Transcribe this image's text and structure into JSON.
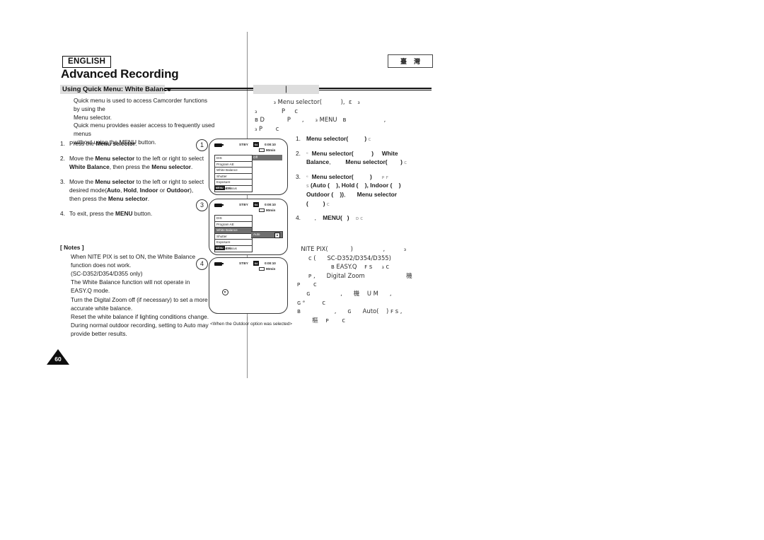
{
  "header": {
    "language_badge": "ENGLISH",
    "locale_badge_chars": [
      "臺",
      "灣"
    ],
    "chapter_title": "Advanced Recording"
  },
  "section": {
    "left_title": "Using Quick Menu: White Balance",
    "right_title": "|"
  },
  "intro": {
    "lines": [
      "Quick menu is used to access Camcorder functions by using the",
      "Menu selector.",
      "Quick menu provides easier access to frequently used menus",
      "without using the MENU button."
    ]
  },
  "steps": [
    {
      "num": "1.",
      "html": "Press the <b>Menu selector</b>."
    },
    {
      "num": "2.",
      "html": "Move the <b>Menu selector</b> to the left or right to select<br><b>White Balance</b>, then press the <b>Menu selector</b>."
    },
    {
      "num": "3.",
      "html": "Move the <b>Menu selector</b> to the left or right to select<br>desired mode(<b>Auto</b>, <b>Hold</b>, <b>Indoor</b> or <b>Outdoor</b>),<br>then press the <b>Menu selector</b>."
    },
    {
      "num": "4.",
      "html": "To exit, press the <b>MENU</b> button."
    }
  ],
  "notes": {
    "title": "[ Notes ]",
    "lines": [
      "When NITE PIX is set to ON, the White Balance",
      "function does not work.",
      "(SC-D352/D354/D355 only)",
      "The White Balance function will not operate in",
      "EASY.Q mode.",
      "Turn the Digital Zoom off (if necessary) to set a more",
      "accurate white balance.",
      "Reset the white balance if lighting conditions change.",
      "During normal outdoor recording, setting to Auto may",
      "provide better results."
    ]
  },
  "screens": {
    "markers": [
      "1",
      "3",
      "4"
    ],
    "status": {
      "stby": "STBY",
      "mode_badge": "64",
      "timecode": "0:00:10",
      "tape_remaining": "90min"
    },
    "menu_items": [
      "DIS",
      "Program AE",
      "White Balance",
      "Shutter",
      "Exposure",
      "Manual Focus"
    ],
    "screen1": {
      "highlight_label": "DIS",
      "highlight_value": "Off"
    },
    "screen3": {
      "highlight_label": "White Balance",
      "highlight_value": "Auto",
      "value_badge": "A"
    },
    "exit": {
      "button": "MENU",
      "label": "Exit"
    },
    "screen4": {
      "icon": "outdoor-icon"
    },
    "caption": "<When the Outdoor option was selected>"
  },
  "right_column": {
    "intro_lines": [
      "          ₃ Menu selector(          ),  ɛ   ₃",
      "₃             P     c",
      "ʙ D            P      ,      ₃ MENU   ʙ                    ,",
      "₃ P       c"
    ],
    "steps": [
      {
        "num": "1.",
        "html": "<b>Menu selector(</b>&nbsp;&nbsp;&nbsp;&nbsp;&nbsp;&nbsp;&nbsp;&nbsp;&nbsp;&nbsp;<b>)</b> <span class=\"g\">c</span>"
      },
      {
        "num": "2.",
        "html": "<span class=\"g\">ᵉ</span>&nbsp; <b>Menu selector(</b>&nbsp;&nbsp;&nbsp;&nbsp;&nbsp;&nbsp;&nbsp;&nbsp;&nbsp;&nbsp;&nbsp;<b>)</b>&nbsp;&nbsp;&nbsp;&nbsp;&nbsp;<b>White</b><br><b>Balance</b>,&nbsp;&nbsp;&nbsp;&nbsp;&nbsp;&nbsp;&nbsp;&nbsp;&nbsp;<b>Menu selector(</b>&nbsp;&nbsp;&nbsp;&nbsp;&nbsp;&nbsp;&nbsp;&nbsp;<b>)</b> <span class=\"g\">c</span>"
      },
      {
        "num": "3.",
        "html": "<span class=\"g\">ᵉ</span>&nbsp; <b>Menu selector(</b>&nbsp;&nbsp;&nbsp;&nbsp;&nbsp;&nbsp;&nbsp;&nbsp;&nbsp;&nbsp;<b>)</b>&nbsp;&nbsp;&nbsp;&nbsp;&nbsp;&nbsp;<span class=\"g\">ᴘ ꜰ</span><br><span class=\"g\">s</span> <b>(Auto (</b>&nbsp;&nbsp;&nbsp;&nbsp;<b>), Hold (</b>&nbsp;&nbsp;&nbsp;&nbsp;<b>), Indoor (</b>&nbsp;&nbsp;&nbsp;&nbsp;<b>)</b><br><b>Outdoor (</b>&nbsp;&nbsp;&nbsp;&nbsp;<b>))</b>,&nbsp;&nbsp;&nbsp;&nbsp;&nbsp;&nbsp;&nbsp;<b>Menu selector</b><br><b>(</b>&nbsp;&nbsp;&nbsp;&nbsp;&nbsp;&nbsp;&nbsp;&nbsp;&nbsp;<b>)</b> <span class=\"g\">c</span>"
      },
      {
        "num": "4.",
        "html": "&nbsp;&nbsp;&nbsp;&nbsp;&nbsp;,&nbsp;&nbsp;&nbsp;&nbsp;<b>MENU(</b>&nbsp;&nbsp;&nbsp;<b>)</b>&nbsp;&nbsp;&nbsp;&nbsp;<span class=\"g\">ᴅ c</span>"
      }
    ],
    "notes_lines": [
      "  NITE PIX(            )                ,          ₃",
      "      c (      SC-D352/D354/D355)",
      "                  ʙ EASY.Q    ꜰ ѕ     ₃ c",
      "      ᴘ ,      Digital Zoom                      機",
      "ᴘ       c",
      "     ɢ                ,      機    U M      ,",
      "ɢ ᵉ         c",
      "ʙ                  ,      ɢ      Auto(    ) ꜰ ѕ ,",
      "        樞    ᴘ       c"
    ]
  }
}
